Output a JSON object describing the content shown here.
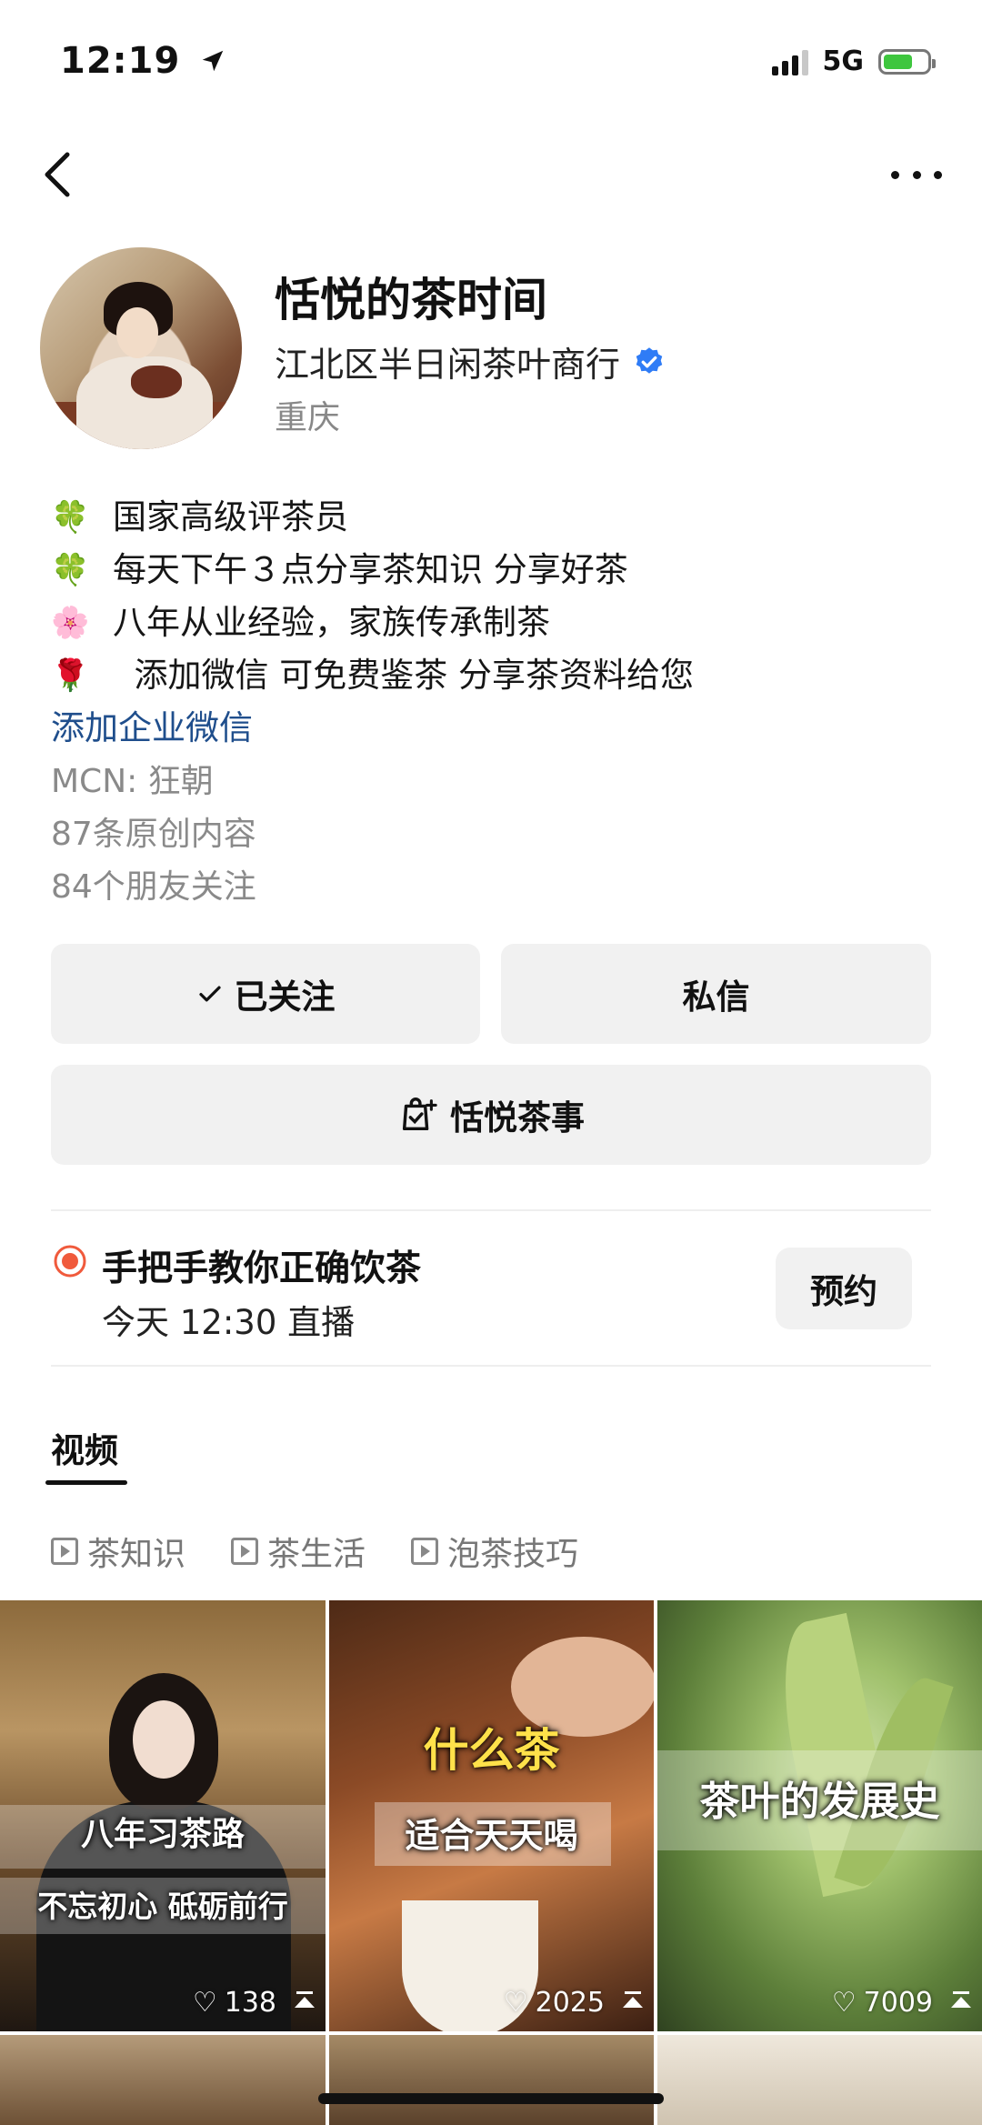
{
  "status": {
    "time": "12:19",
    "network": "5G"
  },
  "profile": {
    "name": "恬悦的茶时间",
    "company": "江北区半日闲茶叶商行",
    "city": "重庆",
    "bio": [
      {
        "emoji": "🍀",
        "text": "国家高级评茶员"
      },
      {
        "emoji": "🍀",
        "text": "每天下午３点分享茶知识  分享好茶"
      },
      {
        "emoji": "🌸",
        "text": "八年从业经验，家族传承制茶"
      },
      {
        "emoji": "🌹",
        "text": "  添加微信 可免费鉴茶 分享茶资料给您"
      }
    ],
    "wechat_link": "添加企业微信",
    "mcn": "MCN: 狂朝",
    "original_count": "87条原创内容",
    "friends_following": "84个朋友关注"
  },
  "actions": {
    "follow_label": "已关注",
    "message_label": "私信",
    "shop_label": "恬悦茶事"
  },
  "live": {
    "title": "手把手教你正确饮茶",
    "time": "今天 12:30 直播",
    "reserve_label": "预约"
  },
  "tabs": {
    "video": "视频"
  },
  "collections": [
    "茶知识",
    "茶生活",
    "泡茶技巧"
  ],
  "videos": [
    {
      "caption1": "八年习茶路",
      "caption2": "不忘初心 砥砺前行",
      "likes": "138"
    },
    {
      "caption1": "什么茶",
      "caption2": "适合天天喝",
      "likes": "2025"
    },
    {
      "caption1": "茶叶的发展史",
      "caption2": "",
      "likes": "7009"
    }
  ],
  "colors": {
    "link": "#1f4e8c",
    "verified": "#2f7cf6",
    "live": "#f05a3c",
    "button_bg": "#f1f1f1"
  }
}
